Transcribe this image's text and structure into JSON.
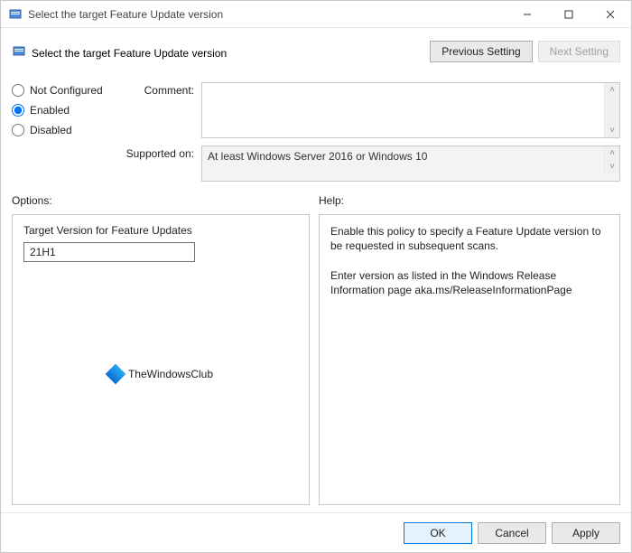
{
  "titlebar": {
    "title": "Select the target Feature Update version"
  },
  "header": {
    "policy_title": "Select the target Feature Update version",
    "prev_label": "Previous Setting",
    "next_label": "Next Setting"
  },
  "state": {
    "not_configured_label": "Not Configured",
    "enabled_label": "Enabled",
    "disabled_label": "Disabled",
    "selected": "Enabled"
  },
  "fields": {
    "comment_label": "Comment:",
    "comment_value": "",
    "supported_label": "Supported on:",
    "supported_value": "At least Windows Server 2016 or Windows 10"
  },
  "columns": {
    "options_label": "Options:",
    "help_label": "Help:"
  },
  "options": {
    "target_version_label": "Target Version for Feature Updates",
    "target_version_value": "21H1"
  },
  "help": {
    "text": "Enable this policy to specify a Feature Update version to be requested in subsequent scans.\n\nEnter version as listed in the Windows Release Information page aka.ms/ReleaseInformationPage"
  },
  "watermark": {
    "text": "TheWindowsClub"
  },
  "footer": {
    "ok": "OK",
    "cancel": "Cancel",
    "apply": "Apply"
  }
}
